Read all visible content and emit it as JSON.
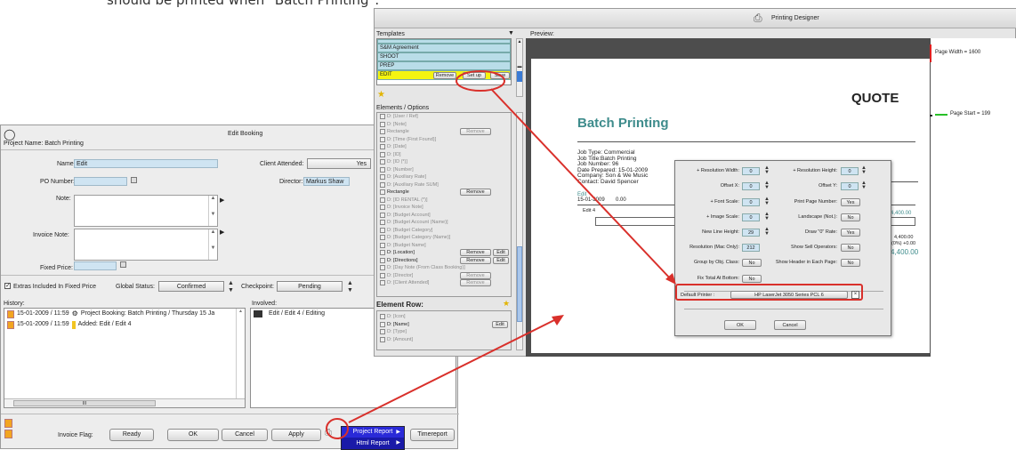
{
  "caption": "should be printed when \"Batch Printing\".",
  "edit_booking": {
    "title": "Edit Booking",
    "project_name": "Project Name: Batch Printing",
    "name_label": "Name:",
    "name_value": "Edit",
    "client_attended_label": "Client Attended:",
    "client_attended_value": "Yes",
    "po_label": "PO Number:",
    "director_label": "Director:",
    "director_value": "Markus Shaw",
    "note_label": "Note:",
    "invoice_note_label": "Invoice Note:",
    "fixed_price_label": "Fixed Price:",
    "extras_label": "Extras Included In Fixed Price",
    "global_status_label": "Global Status:",
    "global_status_value": "Confirmed",
    "checkpoint_label": "Checkpoint:",
    "checkpoint_value": "Pending",
    "history_label": "History:",
    "involved_label": "Involved:",
    "history": [
      "15-01-2009 / 11:59",
      "Project Booking: Batch Printing / Thursday 15 Ja",
      "15-01-2009 / 11:59",
      "Added: Edit / Edit 4"
    ],
    "involved": [
      "Edit / Edit 4 / Editing"
    ],
    "scroll_mark": "III",
    "invoice_flag_label": "Invoice Flag:",
    "invoice_flag_value": "Ready",
    "ok": "OK",
    "cancel": "Cancel",
    "apply": "Apply",
    "timereport": "Timereport",
    "menu": [
      "Project Report",
      "Html Report"
    ]
  },
  "designer": {
    "title": "Printing Designer",
    "templates_label": "Templates",
    "preview_label": "Preview:",
    "templates": [
      "S&M Agreement",
      "SHOOT",
      "PREP",
      "EDIT"
    ],
    "template_remove": "Remove",
    "template_setup": "Set up",
    "template_save": "Save",
    "elements_label": "Elements / Options",
    "elements": [
      {
        "t": "D: [User / Ref]",
        "b": false,
        "btns": []
      },
      {
        "t": "D: [Note]",
        "b": false,
        "btns": []
      },
      {
        "t": "Rectangle",
        "b": false,
        "btns": [
          "Remove"
        ]
      },
      {
        "t": "D: [Time (First Found)]",
        "b": false,
        "btns": []
      },
      {
        "t": "D: [Date]",
        "b": false,
        "btns": []
      },
      {
        "t": "D: [ID]",
        "b": false,
        "btns": []
      },
      {
        "t": "D: [ID (*)]",
        "b": false,
        "btns": []
      },
      {
        "t": "D: [Number]",
        "b": false,
        "btns": []
      },
      {
        "t": "D: [Auxiliary Rate]",
        "b": false,
        "btns": []
      },
      {
        "t": "D: [Auxiliary Rate SUM]",
        "b": false,
        "btns": []
      },
      {
        "t": "Rectangle",
        "b": true,
        "btns": [
          "Remove"
        ]
      },
      {
        "t": "D: [ID RENTAL (*)]",
        "b": false,
        "btns": []
      },
      {
        "t": "D: [Invoice Note]",
        "b": false,
        "btns": []
      },
      {
        "t": "D: [Budget Account]",
        "b": false,
        "btns": []
      },
      {
        "t": "D: [Budget Account (Name)]",
        "b": false,
        "btns": []
      },
      {
        "t": "D: [Budget Category]",
        "b": false,
        "btns": []
      },
      {
        "t": "D: [Budget Category (Name)]",
        "b": false,
        "btns": []
      },
      {
        "t": "D: [Budget Name]",
        "b": false,
        "btns": []
      },
      {
        "t": "D: [Location]",
        "b": true,
        "btns": [
          "Remove",
          "Edit"
        ]
      },
      {
        "t": "D: [Directions]",
        "b": true,
        "btns": [
          "Remove",
          "Edit"
        ]
      },
      {
        "t": "D: [Day Note (From Class Booking)]",
        "b": false,
        "btns": []
      },
      {
        "t": "D: [Director]",
        "b": false,
        "btns": [
          "Remove"
        ]
      },
      {
        "t": "D: [Client Attended]",
        "b": false,
        "btns": [
          "Remove"
        ]
      }
    ],
    "element_row_label": "Element Row:",
    "element_rows": [
      {
        "t": "D: [Icon]",
        "b": false
      },
      {
        "t": "D: [Name]",
        "b": true
      },
      {
        "t": "D: [Type]",
        "b": false
      },
      {
        "t": "D: [Amount]",
        "b": false
      }
    ],
    "element_row_edit": "Edit",
    "page_width": "Page Width = 1600",
    "page_start": "Page Start = 199",
    "paper": {
      "quote": "QUOTE",
      "heading": "Batch Printing",
      "info": [
        "Job Type: Commercial",
        "Job Title:Batch Printing",
        "Job Number: 96",
        "Date Prepared: 15-01-2009",
        "Company: Son & We Music",
        "Contact: David Spencer"
      ],
      "edit_label": "Edit",
      "date": "15-01-2009",
      "zero": "0.00",
      "edit4": "Edit 4",
      "amount1": "4,400.00",
      "amount2": "4,400.00",
      "amount3": "(0%) +0.00",
      "amount4": "4,400.00"
    },
    "dialog": {
      "left_labels": [
        "+ Resolution Width:",
        "Offset X:",
        "+ Font Scale:",
        "+ Image Scale:",
        "New Line Height:",
        "Resolution (Mac Only):",
        "Group by Obj. Class:",
        "Fix Total At Bottom:"
      ],
      "left_values": [
        "0",
        "0",
        "0",
        "0",
        "29",
        "212",
        "No",
        "No"
      ],
      "right_labels": [
        "+ Resolution Height:",
        "Offset Y:",
        "Print Page Number:",
        "Landscape (Not.):",
        "Draw \"0\" Rate:",
        "Show Sell Operators:",
        "Show Header in Each Page:"
      ],
      "right_values": [
        "0",
        "0",
        "Yes",
        "No",
        "Yes",
        "No",
        "No"
      ],
      "default_printer_label": "Default Printer :",
      "default_printer_value": "HP LaserJet 3050 Series PCL 6",
      "ok": "OK",
      "cancel": "Cancel"
    }
  }
}
